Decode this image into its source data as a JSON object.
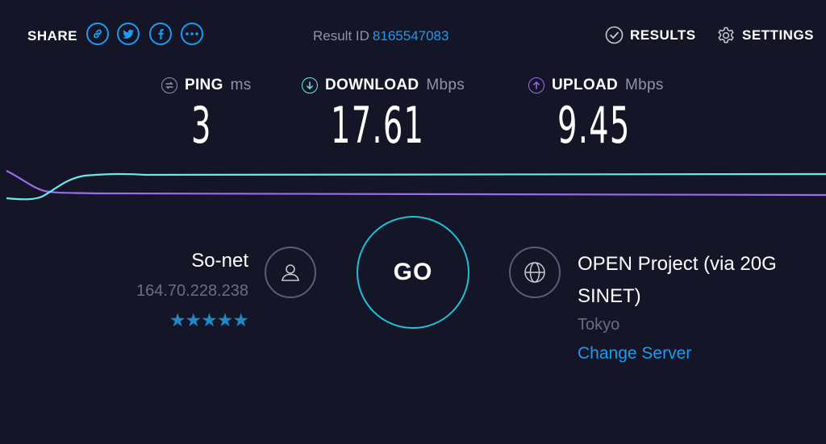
{
  "header": {
    "share_label": "SHARE",
    "share_icons": [
      "link-icon",
      "twitter-icon",
      "facebook-icon",
      "more-icon"
    ],
    "result_label": "Result ID",
    "result_id": "8165547083",
    "results_label": "RESULTS",
    "settings_label": "SETTINGS"
  },
  "metrics": {
    "ping": {
      "label": "PING",
      "unit": "ms",
      "value": "3"
    },
    "download": {
      "label": "DOWNLOAD",
      "unit": "Mbps",
      "value": "17.61"
    },
    "upload": {
      "label": "UPLOAD",
      "unit": "Mbps",
      "value": "9.45"
    }
  },
  "isp": {
    "name": "So-net",
    "ip": "164.70.228.238",
    "stars": "★★★★★",
    "rating": 5
  },
  "go_label": "GO",
  "server": {
    "name": "OPEN Project (via 20G SINET)",
    "location": "Tokyo",
    "change_label": "Change Server"
  },
  "colors": {
    "background": "#141526",
    "accent_blue": "#1d9bf0",
    "download_cyan": "#6fe6ec",
    "upload_purple": "#9b6cf0",
    "star_blue": "#1d8ac8",
    "muted": "#9194a6"
  }
}
